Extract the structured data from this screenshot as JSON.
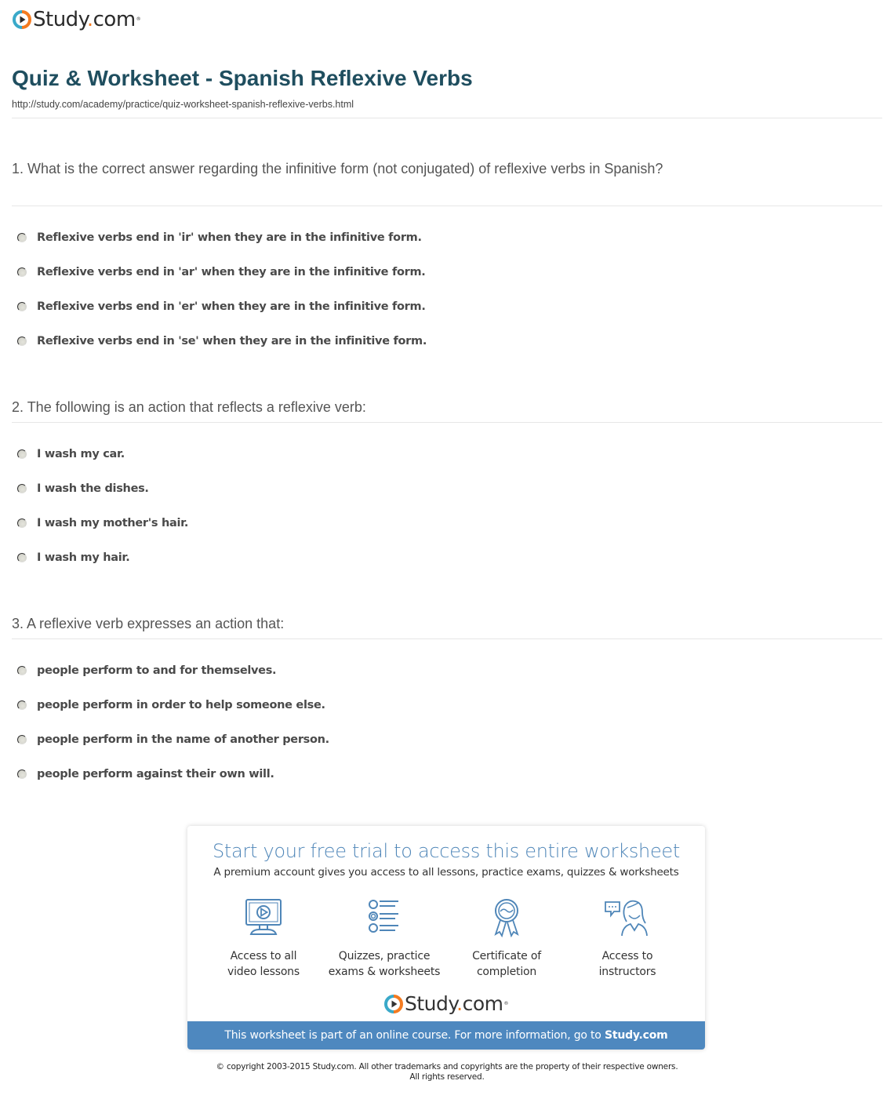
{
  "brand": {
    "name_main": "Study",
    "name_dot": ".",
    "name_tld": "com",
    "colors": {
      "ring_teal": "#3aa9c9",
      "ring_orange": "#f47b20",
      "title": "#1f4e5f",
      "accent_blue": "#4e88bf"
    }
  },
  "header": {
    "title": "Quiz & Worksheet - Spanish Reflexive Verbs",
    "url": "http://study.com/academy/practice/quiz-worksheet-spanish-reflexive-verbs.html"
  },
  "questions": [
    {
      "text": "1. What is the correct answer regarding the infinitive form (not conjugated) of reflexive verbs in Spanish?",
      "answers": [
        "Reflexive verbs end in 'ir' when they are in the infinitive form.",
        "Reflexive verbs end in 'ar' when they are in the infinitive form.",
        "Reflexive verbs end in 'er' when they are in the infinitive form.",
        "Reflexive verbs end in 'se' when they are in the infinitive form."
      ]
    },
    {
      "text": "2. The following is an action that reflects a reflexive verb:",
      "answers": [
        "I wash my car.",
        "I wash the dishes.",
        "I wash my mother's hair.",
        "I wash my hair."
      ]
    },
    {
      "text": "3. A reflexive verb expresses an action that:",
      "answers": [
        "people perform to and for themselves.",
        "people perform in order to help someone else.",
        "people perform in the name of another person.",
        "people perform against their own will."
      ]
    }
  ],
  "promo": {
    "title": "Start your free trial to access this entire worksheet",
    "subtitle": "A premium account gives you access to all lessons, practice exams, quizzes & worksheets",
    "features": [
      {
        "icon": "monitor-play-icon",
        "line1": "Access to all",
        "line2": "video lessons"
      },
      {
        "icon": "quiz-list-icon",
        "line1": "Quizzes, practice",
        "line2": "exams & worksheets"
      },
      {
        "icon": "certificate-ribbon-icon",
        "line1": "Certificate of",
        "line2": "completion"
      },
      {
        "icon": "instructor-chat-icon",
        "line1": "Access to",
        "line2": "instructors"
      }
    ],
    "bar_text": "This worksheet is part of an online course. For more information, go to",
    "bar_link": "Study.com"
  },
  "footer": {
    "line1": "© copyright 2003-2015 Study.com. All other trademarks and copyrights are the property of their respective owners.",
    "line2": "All rights reserved."
  }
}
